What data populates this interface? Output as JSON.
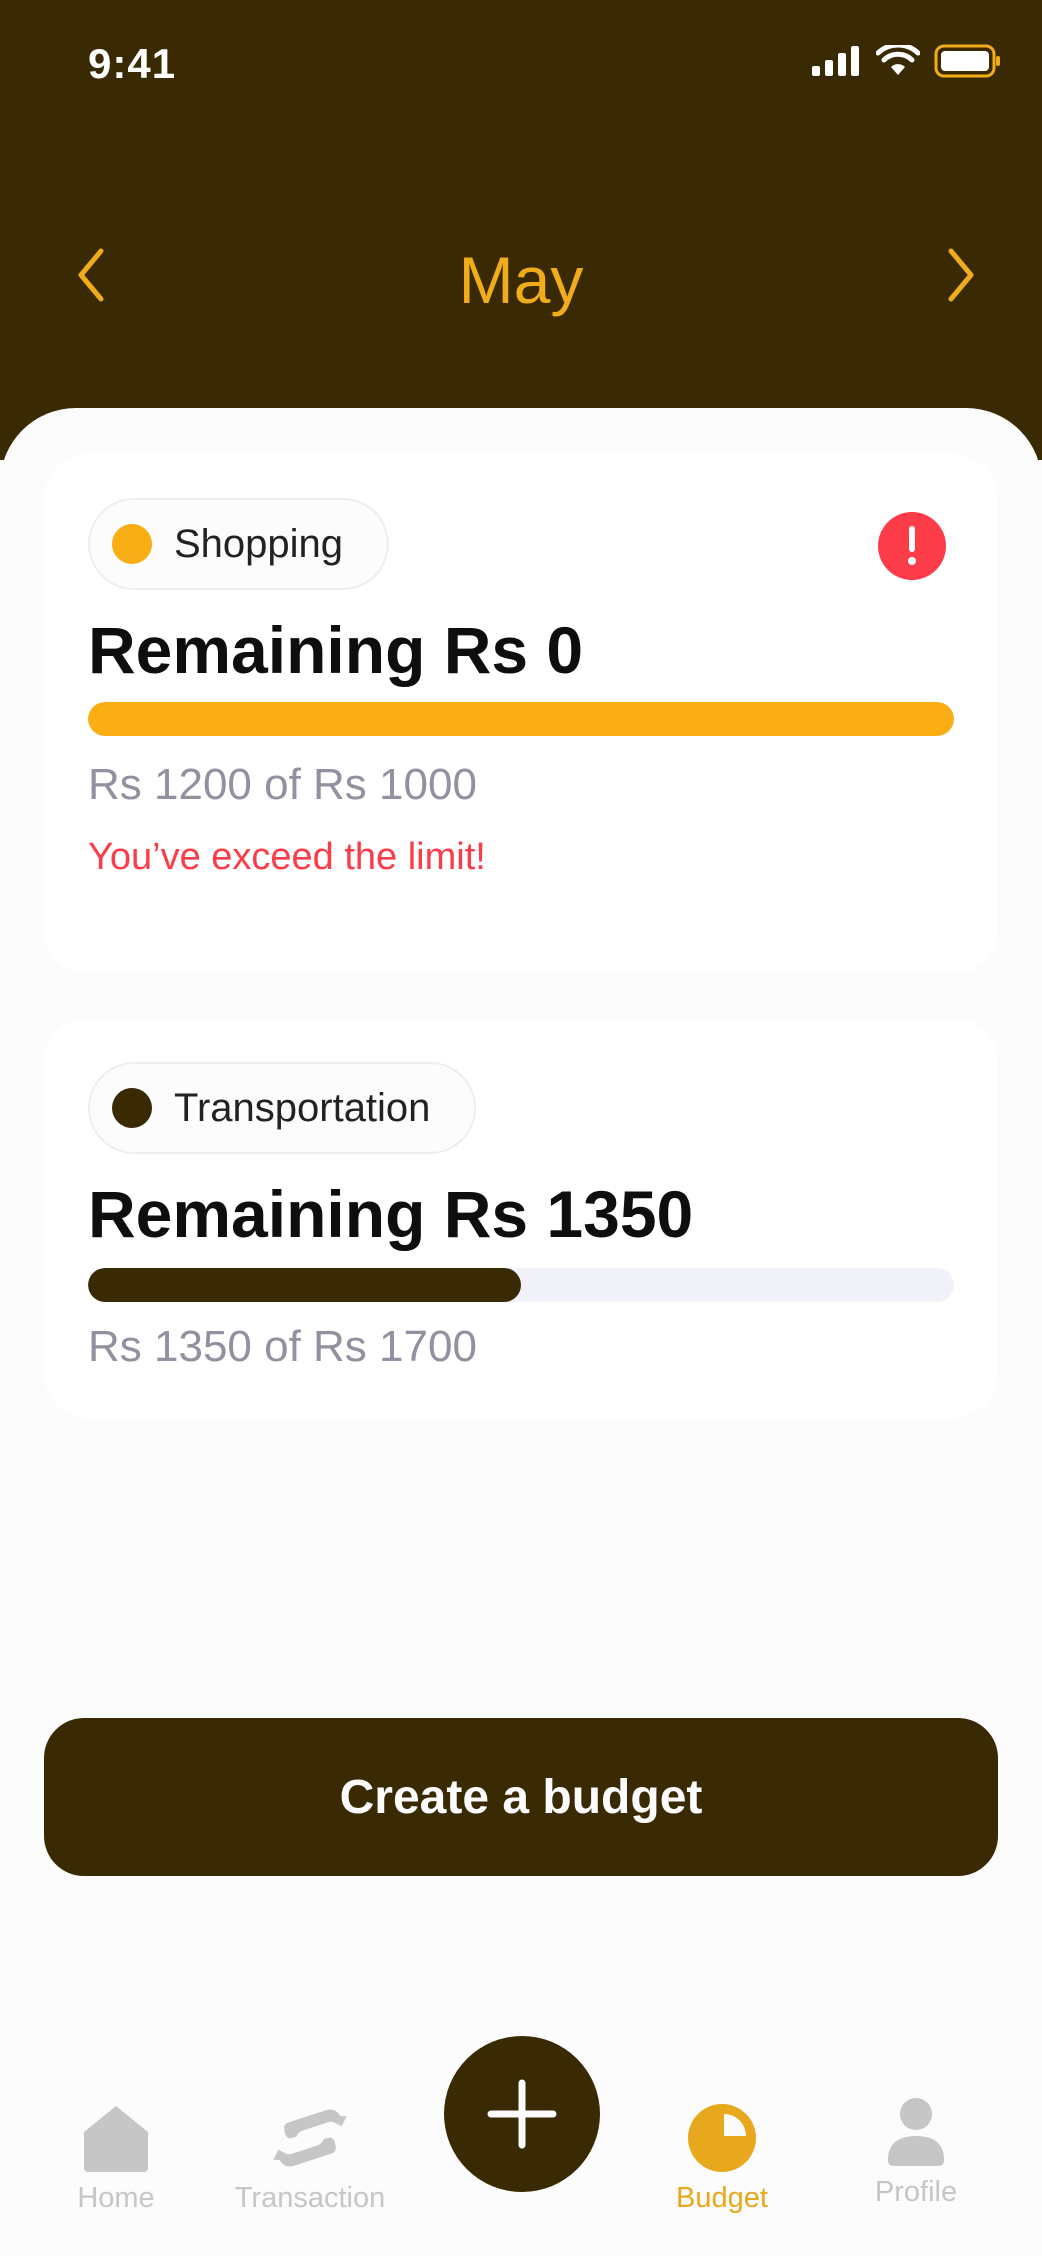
{
  "status_bar": {
    "time": "9:41"
  },
  "header": {
    "month": "May"
  },
  "budgets": [
    {
      "category": "Shopping",
      "dot_color": "#F8AE14",
      "remaining": "Remaining Rs 0",
      "amount": "Rs 1200 of Rs 1000",
      "warning": "You’ve exceed the limit!",
      "progress": 1.0,
      "bar_color": "#FAAE14"
    },
    {
      "category": "Transportation",
      "dot_color": "#3A2A04",
      "remaining": "Remaining Rs 1350",
      "amount": "Rs 1350 of Rs 1700",
      "progress": 0.5,
      "bar_color": "#3A2A04"
    }
  ],
  "actions": {
    "create_budget": "Create a budget"
  },
  "tabs": [
    {
      "label": "Home",
      "icon": "home-icon"
    },
    {
      "label": "Transaction",
      "icon": "transaction-icon"
    },
    {
      "label": "Budget",
      "icon": "pie-chart-icon",
      "active": true
    },
    {
      "label": "Profile",
      "icon": "user-icon"
    }
  ],
  "colors": {
    "header_bg": "#3A2A04",
    "accent": "#F0AC1A",
    "danger": "#FD3C4A"
  }
}
